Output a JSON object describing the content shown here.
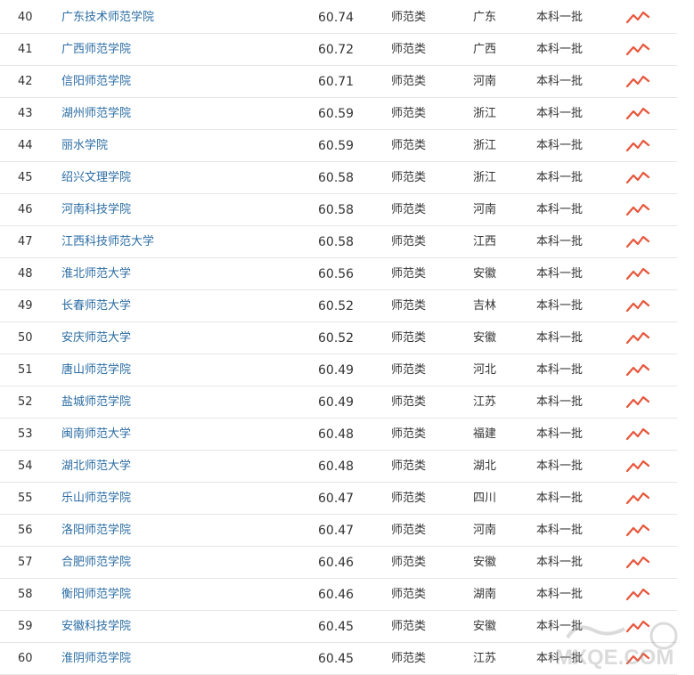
{
  "table": {
    "rows": [
      {
        "rank": "40",
        "name": "广东技术师范学院",
        "score": "60.74",
        "type": "师范类",
        "province": "广东",
        "batch": "本科一批"
      },
      {
        "rank": "41",
        "name": "广西师范学院",
        "score": "60.72",
        "type": "师范类",
        "province": "广西",
        "batch": "本科一批"
      },
      {
        "rank": "42",
        "name": "信阳师范学院",
        "score": "60.71",
        "type": "师范类",
        "province": "河南",
        "batch": "本科一批"
      },
      {
        "rank": "43",
        "name": "湖州师范学院",
        "score": "60.59",
        "type": "师范类",
        "province": "浙江",
        "batch": "本科一批"
      },
      {
        "rank": "44",
        "name": "丽水学院",
        "score": "60.59",
        "type": "师范类",
        "province": "浙江",
        "batch": "本科一批"
      },
      {
        "rank": "45",
        "name": "绍兴文理学院",
        "score": "60.58",
        "type": "师范类",
        "province": "浙江",
        "batch": "本科一批"
      },
      {
        "rank": "46",
        "name": "河南科技学院",
        "score": "60.58",
        "type": "师范类",
        "province": "河南",
        "batch": "本科一批"
      },
      {
        "rank": "47",
        "name": "江西科技师范大学",
        "score": "60.58",
        "type": "师范类",
        "province": "江西",
        "batch": "本科一批"
      },
      {
        "rank": "48",
        "name": "淮北师范大学",
        "score": "60.56",
        "type": "师范类",
        "province": "安徽",
        "batch": "本科一批"
      },
      {
        "rank": "49",
        "name": "长春师范大学",
        "score": "60.52",
        "type": "师范类",
        "province": "吉林",
        "batch": "本科一批"
      },
      {
        "rank": "50",
        "name": "安庆师范大学",
        "score": "60.52",
        "type": "师范类",
        "province": "安徽",
        "batch": "本科一批"
      },
      {
        "rank": "51",
        "name": "唐山师范学院",
        "score": "60.49",
        "type": "师范类",
        "province": "河北",
        "batch": "本科一批"
      },
      {
        "rank": "52",
        "name": "盐城师范学院",
        "score": "60.49",
        "type": "师范类",
        "province": "江苏",
        "batch": "本科一批"
      },
      {
        "rank": "53",
        "name": "闽南师范大学",
        "score": "60.48",
        "type": "师范类",
        "province": "福建",
        "batch": "本科一批"
      },
      {
        "rank": "54",
        "name": "湖北师范大学",
        "score": "60.48",
        "type": "师范类",
        "province": "湖北",
        "batch": "本科一批"
      },
      {
        "rank": "55",
        "name": "乐山师范学院",
        "score": "60.47",
        "type": "师范类",
        "province": "四川",
        "batch": "本科一批"
      },
      {
        "rank": "56",
        "name": "洛阳师范学院",
        "score": "60.47",
        "type": "师范类",
        "province": "河南",
        "batch": "本科一批"
      },
      {
        "rank": "57",
        "name": "合肥师范学院",
        "score": "60.46",
        "type": "师范类",
        "province": "安徽",
        "batch": "本科一批"
      },
      {
        "rank": "58",
        "name": "衡阳师范学院",
        "score": "60.46",
        "type": "师范类",
        "province": "湖南",
        "batch": "本科一批"
      },
      {
        "rank": "59",
        "name": "安徽科技学院",
        "score": "60.45",
        "type": "师范类",
        "province": "安徽",
        "batch": "本科一批"
      },
      {
        "rank": "60",
        "name": "淮阴师范学院",
        "score": "60.45",
        "type": "师范类",
        "province": "江苏",
        "batch": "本科一批"
      }
    ],
    "trend_icon": "trend-line-icon",
    "trend_color": "#e8553a"
  },
  "watermark": {
    "text": "MXQE.COM",
    "icon": "watermark-logo",
    "color": "#b0b0b0"
  }
}
